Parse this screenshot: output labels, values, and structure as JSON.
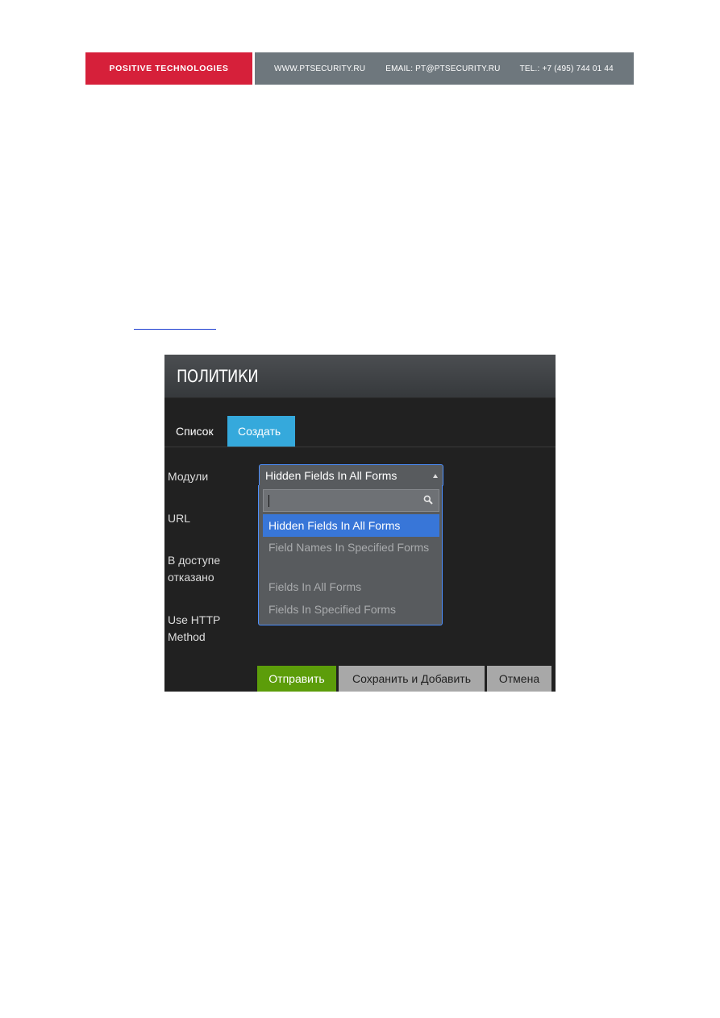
{
  "banner": {
    "brand": "POSITIVE TECHNOLOGIES",
    "site": "WWW.PTSECURITY.RU",
    "email": "EMAIL: PT@PTSECURITY.RU",
    "tel": "TEL.: +7 (495) 744 01 44",
    "colors": {
      "brand_bg": "#d6203a",
      "contact_bg": "#6e777d"
    }
  },
  "panel": {
    "title": "ПОЛИТИКИ",
    "tabs": [
      {
        "label": "Список",
        "active": false
      },
      {
        "label": "Создать",
        "active": true
      }
    ],
    "form": {
      "labels": {
        "modules": "Модули",
        "url": "URL",
        "denied": "В доступе отказано",
        "http": "Use HTTP Method"
      },
      "modules_select": {
        "selected": "Hidden Fields In All Forms",
        "search_value": "",
        "options": [
          "Hidden Fields In All Forms",
          "Field Names In Specified Forms",
          "Fields In All Forms",
          "Fields In Specified Forms"
        ],
        "highlighted_index": 0
      }
    },
    "buttons": {
      "submit": "Отправить",
      "save_add": "Сохранить и Добавить",
      "cancel": "Отмена"
    },
    "colors": {
      "tab_active": "#35a9dc",
      "highlight": "#3876d8",
      "submit_bg": "#5c9d0a"
    }
  }
}
